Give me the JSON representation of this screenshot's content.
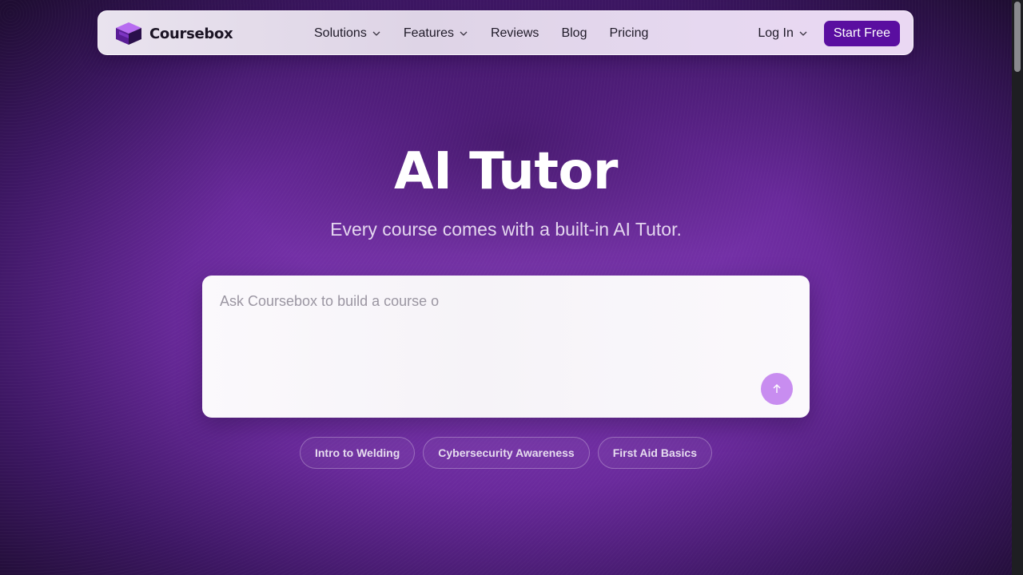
{
  "nav": {
    "brand": "Coursebox",
    "links": [
      {
        "label": "Solutions",
        "dropdown": true
      },
      {
        "label": "Features",
        "dropdown": true
      },
      {
        "label": "Reviews",
        "dropdown": false
      },
      {
        "label": "Blog",
        "dropdown": false
      },
      {
        "label": "Pricing",
        "dropdown": false
      }
    ],
    "login_label": "Log In",
    "cta_label": "Start Free"
  },
  "hero": {
    "title": "AI Tutor",
    "subtitle": "Every course comes with a built-in AI Tutor."
  },
  "prompt": {
    "placeholder": "Ask Coursebox to build a course o",
    "value": "",
    "send_icon": "arrow-up-icon"
  },
  "suggestions": [
    "Intro to Welding",
    "Cybersecurity Awareness",
    "First Aid Basics"
  ],
  "colors": {
    "brand_purple": "#5a0ea0",
    "send_button": "#c88df0",
    "background": "#6a2a9c"
  }
}
